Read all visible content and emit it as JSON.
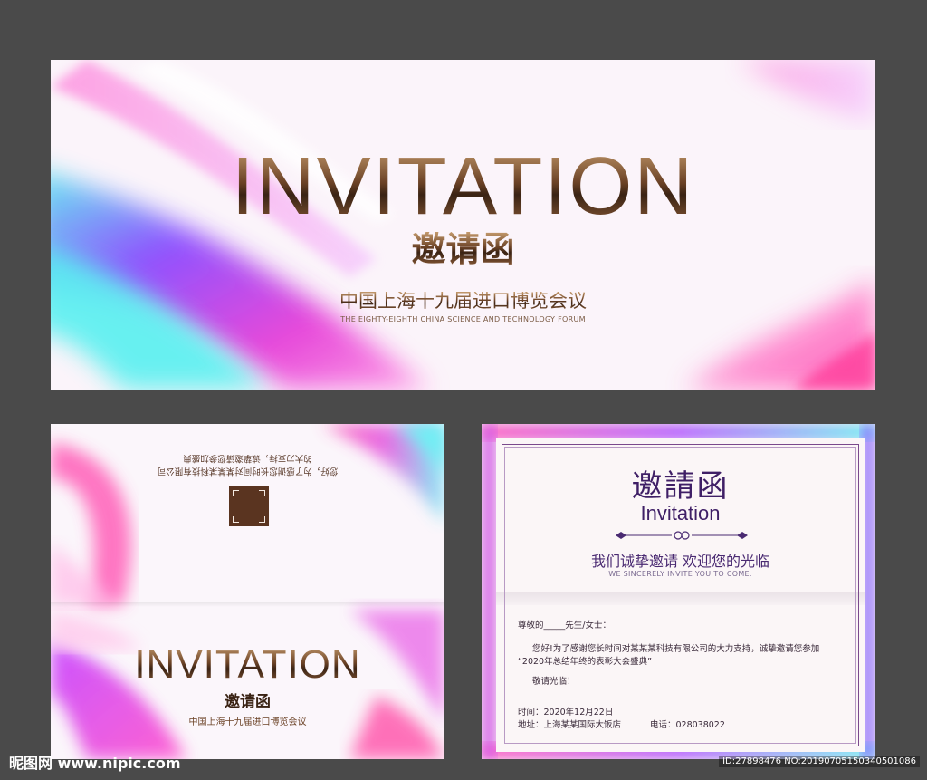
{
  "top_card": {
    "title": "INVITATION",
    "subtitle": "邀请函",
    "event": "中国上海十九届进口博览会议",
    "event_en": "THE EIGHTY-EIGHTH CHINA SCIENCE AND TECHNOLOGY FORUM"
  },
  "bottom_left": {
    "upside_line1": "您好，为了感谢您长时间对某某某科技有限公司",
    "upside_line2": "的大力支持，诚挚邀请您参加盛典",
    "title": "INVITATION",
    "subtitle": "邀请函",
    "event": "中国上海十九届进口博览会议"
  },
  "bottom_right": {
    "title_cn": "邀請函",
    "title_en": "Invitation",
    "heading": "我们诚挚邀请 欢迎您的光临",
    "heading_en": "WE SINCERELY INVITE YOU TO COME.",
    "greeting": "尊敬的_____先生/女士：",
    "body_line1": "您好!为了感谢您长时间对某某某科技有限公司的大力支持，诚挚邀请您参加",
    "body_line2": "“2020年总结年终的表彰大会盛典”",
    "welcome": "敬请光临！",
    "time": "时间：2020年12月22日",
    "address": "地址：上海某某国际大饭店",
    "phone": "电话：028038022"
  },
  "watermark": {
    "left": "昵图网 www.nipic.com",
    "right": "ID:27898476 NO:20190705150340501086"
  },
  "colors": {
    "background": "#4a4a4a",
    "gold_dark": "#3a2314",
    "purple_text": "#3f1f66"
  }
}
